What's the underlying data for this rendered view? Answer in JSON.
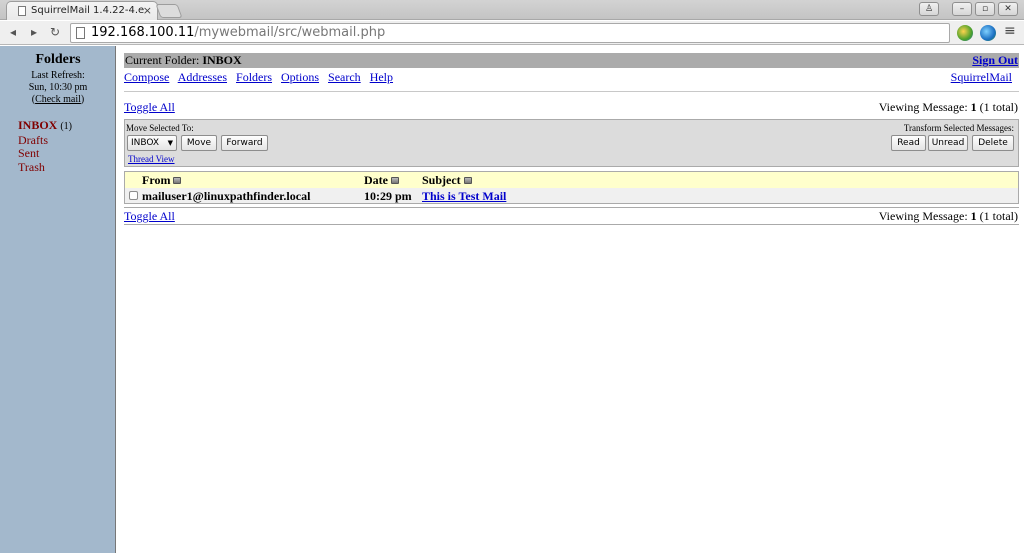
{
  "browser": {
    "tab_title": "SquirrelMail 1.4.22-4.e",
    "tab_close": "×",
    "url_host": "192.168.100.11",
    "url_path": "/mywebmail/src/webmail.php",
    "nav_back": "◂",
    "nav_forward": "▸",
    "nav_reload": "↻",
    "window_user": "♙",
    "window_min": "–",
    "window_max": "▫",
    "window_close": "✕",
    "menu": "≡"
  },
  "left": {
    "title": "Folders",
    "last_refresh_label": "Last Refresh:",
    "last_refresh_time": "Sun, 10:30 pm",
    "check_mail": "Check mail",
    "folders": [
      {
        "label": "INBOX",
        "count": "(1)"
      },
      {
        "label": "Drafts"
      },
      {
        "label": "Sent"
      },
      {
        "label": "Trash"
      }
    ]
  },
  "header": {
    "current_folder_label": "Current Folder:",
    "current_folder": "INBOX",
    "sign_out": "Sign Out",
    "menu": [
      "Compose",
      "Addresses",
      "Folders",
      "Options",
      "Search",
      "Help"
    ],
    "squirrelmail_link": "SquirrelMail"
  },
  "list": {
    "toggle_all": "Toggle All",
    "viewing_prefix": "Viewing Message:",
    "viewing_num": "1",
    "viewing_suffix": "(1 total)",
    "move_selected_label": "Move Selected To:",
    "transform_label": "Transform Selected Messages:",
    "move_target": "INBOX",
    "move_button": "Move",
    "forward_button": "Forward",
    "read_button": "Read",
    "unread_button": "Unread",
    "delete_button": "Delete",
    "thread_view": "Thread View",
    "columns": {
      "from": "From",
      "date": "Date",
      "subject": "Subject"
    },
    "messages": [
      {
        "from": "mailuser1@linuxpathfinder.local",
        "date": "10:29 pm",
        "subject": "This is Test Mail"
      }
    ]
  }
}
